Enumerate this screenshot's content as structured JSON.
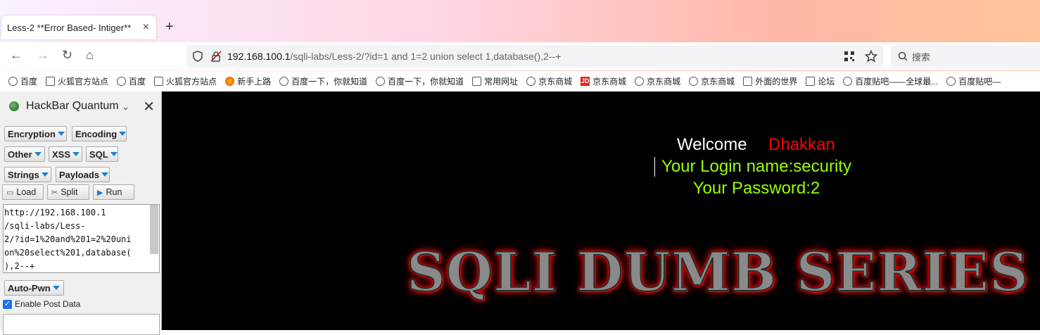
{
  "browser": {
    "tab_title": "Less-2 **Error Based- Intiger**",
    "tab_close": "×",
    "new_tab": "+",
    "url_host": "192.168.100.1",
    "url_path": "/sqli-labs/Less-2/?id=1 and 1=2 union select 1,database(),2--+",
    "search_placeholder": "搜索",
    "nav": {
      "back": "←",
      "forward": "→",
      "reload": "↻",
      "home": "⌂"
    },
    "bookmarks": [
      {
        "label": "百度",
        "icon": "globe-icon"
      },
      {
        "label": "火狐官方站点",
        "icon": "folder-icon"
      },
      {
        "label": "百度",
        "icon": "globe-icon"
      },
      {
        "label": "火狐官方站点",
        "icon": "folder-icon"
      },
      {
        "label": "新手上路",
        "icon": "firefox-icon"
      },
      {
        "label": "百度一下，你就知道",
        "icon": "globe-icon"
      },
      {
        "label": "百度一下，你就知道",
        "icon": "globe-icon"
      },
      {
        "label": "常用网址",
        "icon": "folder-icon"
      },
      {
        "label": "京东商城",
        "icon": "globe-icon"
      },
      {
        "label": "京东商城",
        "icon": "jd-icon"
      },
      {
        "label": "京东商城",
        "icon": "globe-icon"
      },
      {
        "label": "京东商城",
        "icon": "globe-icon"
      },
      {
        "label": "外面的世界",
        "icon": "folder-icon"
      },
      {
        "label": "论坛",
        "icon": "folder-icon"
      },
      {
        "label": "百度贴吧——全球最...",
        "icon": "globe-icon"
      },
      {
        "label": "百度贴吧—",
        "icon": "globe-icon"
      }
    ]
  },
  "hackbar": {
    "title": "HackBar Quantum",
    "title_caret": "⌄",
    "close": "✕",
    "menus": {
      "encryption": "Encryption",
      "encoding": "Encoding",
      "other": "Other",
      "xss": "XSS",
      "sql": "SQL",
      "strings": "Strings",
      "payloads": "Payloads",
      "auto_pwn": "Auto-Pwn"
    },
    "actions": {
      "load": "Load",
      "split": "Split",
      "run": "Run"
    },
    "url_text": "http://192.168.100.1\n/sqli-labs/Less-\n2/?id=1%20and%201=2%20uni\non%20select%201,database(\n),2--+",
    "enable_post": "Enable Post Data",
    "enable_post_checked": true
  },
  "page": {
    "welcome": "Welcome",
    "user": "Dhakkan",
    "login_name": "Your Login name:security",
    "password": "Your Password:2",
    "banner": "SQLI DUMB SERIES"
  },
  "colors": {
    "login_green": "#99ff00",
    "user_red": "#ff0000",
    "banner_glow": "#ff0000"
  }
}
